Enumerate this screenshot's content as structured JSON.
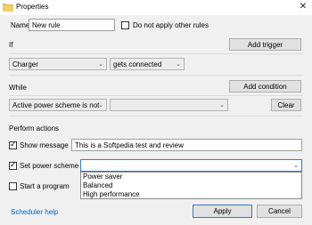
{
  "window": {
    "title": "Properties",
    "close_glyph": "✕"
  },
  "name_row": {
    "label": "Name",
    "value": "New rule",
    "checkbox_label": "Do not apply other rules",
    "checkbox_checked": false
  },
  "if_section": {
    "label": "If",
    "add_trigger": "Add trigger",
    "trigger_value": "Charger",
    "condition_value": "gets connected"
  },
  "while_section": {
    "label": "While",
    "add_condition": "Add condition",
    "condition_value": "Active power scheme is not",
    "value": "",
    "clear": "Clear"
  },
  "actions": {
    "label": "Perform actions",
    "show_message": {
      "label": "Show message",
      "checked": true,
      "value": "This is a Softpedia test and review"
    },
    "set_power_scheme": {
      "label": "Set power scheme",
      "checked": true,
      "value": ""
    },
    "start_program": {
      "label": "Start a program",
      "checked": false
    },
    "power_scheme_options": [
      "Power saver",
      "Balanced",
      "High performance"
    ],
    "highlighted_option": "Power saver"
  },
  "footer": {
    "help_link": "Scheduler help",
    "apply": "Apply",
    "cancel": "Cancel"
  },
  "icons": {
    "window_icon": "folder-icon",
    "chevron": "chevron-down-icon"
  }
}
